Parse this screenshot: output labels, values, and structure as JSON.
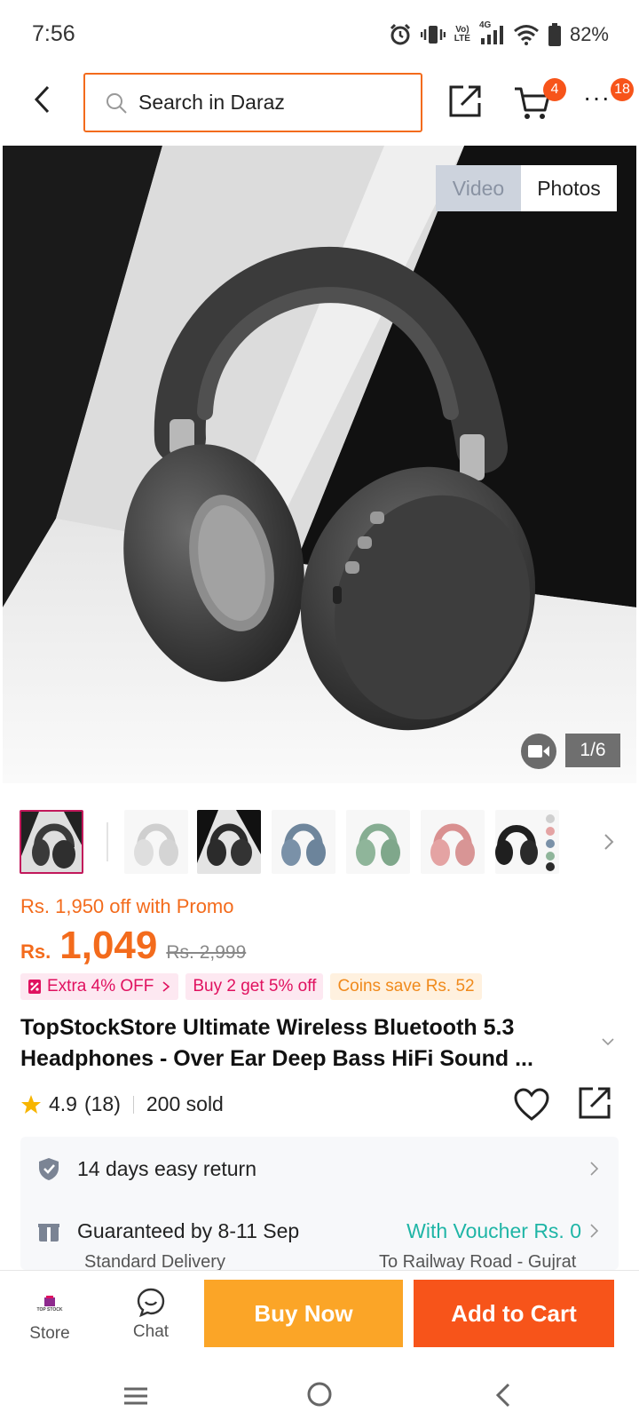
{
  "status_bar": {
    "time": "7:56",
    "network_volte": "Vo)",
    "network_lte": "LTE",
    "network_gen": "4G",
    "battery": "82%",
    "icons": [
      "alarm-icon",
      "vibrate-icon",
      "signal-icon",
      "wifi-icon",
      "battery-icon"
    ]
  },
  "header": {
    "search_placeholder": "Search in Daraz",
    "cart_count": "4",
    "more_count": "18",
    "more_label": "···"
  },
  "gallery": {
    "toggle": {
      "video": "Video",
      "photos": "Photos",
      "selected": "Photos"
    },
    "counter": "1/6",
    "thumbnails": [
      {
        "name": "thumb-gray-headphones",
        "selected": true,
        "color": "#3a3a3a"
      },
      {
        "name": "thumb-silver-headphones",
        "color": "#e8e8e8"
      },
      {
        "name": "thumb-black-headphones",
        "color": "#2b2b2b"
      },
      {
        "name": "thumb-blue-headphones",
        "color": "#7a91a8"
      },
      {
        "name": "thumb-green-headphones",
        "color": "#8fb59a"
      },
      {
        "name": "thumb-pink-headphones",
        "color": "#e4a3a3"
      },
      {
        "name": "thumb-multicolor-headphones",
        "color": "#1f1f1f"
      }
    ]
  },
  "pricing": {
    "promo": "Rs. 1,950 off with Promo",
    "currency": "Rs.",
    "price": "1,049",
    "original_price": "Rs. 2,999",
    "tags": [
      {
        "label": "Extra 4% OFF",
        "style": "pink"
      },
      {
        "label": "Buy 2 get 5% off",
        "style": "pink"
      },
      {
        "label": "Coins save Rs. 52",
        "style": "orange"
      }
    ]
  },
  "product": {
    "title_line1": "TopStockStore Ultimate Wireless Bluetooth 5.3",
    "title_line2": "Headphones - Over Ear Deep Bass HiFi Sound ...",
    "rating": "4.9",
    "rating_count": "(18)",
    "sold": "200 sold"
  },
  "delivery": {
    "return_text": "14 days easy return",
    "guarantee_text": "Guaranteed by 8-11 Sep",
    "voucher_text": "With Voucher Rs. 0",
    "delivery_type": "Standard Delivery",
    "location": "To Railway Road - Gujrat"
  },
  "action_bar": {
    "store_label": "Store",
    "store_logo_text": "TOP STOCK",
    "chat_label": "Chat",
    "buy_now": "Buy Now",
    "add_to_cart": "Add to Cart"
  },
  "colors": {
    "brand_orange": "#f7541a",
    "price_orange": "#f36b1c",
    "buy_now": "#fba527",
    "tag_pink": "#e0115f",
    "voucher_teal": "#1fb5a6"
  }
}
